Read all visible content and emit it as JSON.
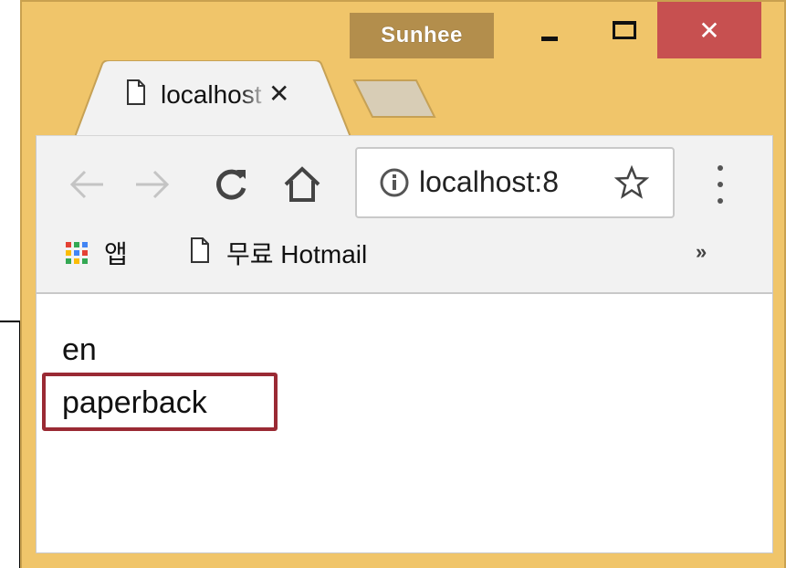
{
  "window": {
    "profile_name": "Sunhee",
    "close_glyph": "✕",
    "colors": {
      "frame": "#f0c56a",
      "profile_bg": "#b38e4c",
      "close_bg": "#c75050",
      "highlight_border": "#9a2a34"
    }
  },
  "tab": {
    "title": "localhost",
    "close_glyph": "✕",
    "icon": "page-icon"
  },
  "toolbar": {
    "address": "localhost:8",
    "icons": [
      "back-arrow-icon",
      "forward-arrow-icon",
      "reload-icon",
      "home-icon",
      "info-icon",
      "star-icon",
      "menu-dots-icon"
    ]
  },
  "bookmarks": {
    "apps_label": "앱",
    "hotmail_label": "무료 Hotmail",
    "more_glyph": "»"
  },
  "page": {
    "lines": [
      "en",
      "paperback"
    ]
  }
}
